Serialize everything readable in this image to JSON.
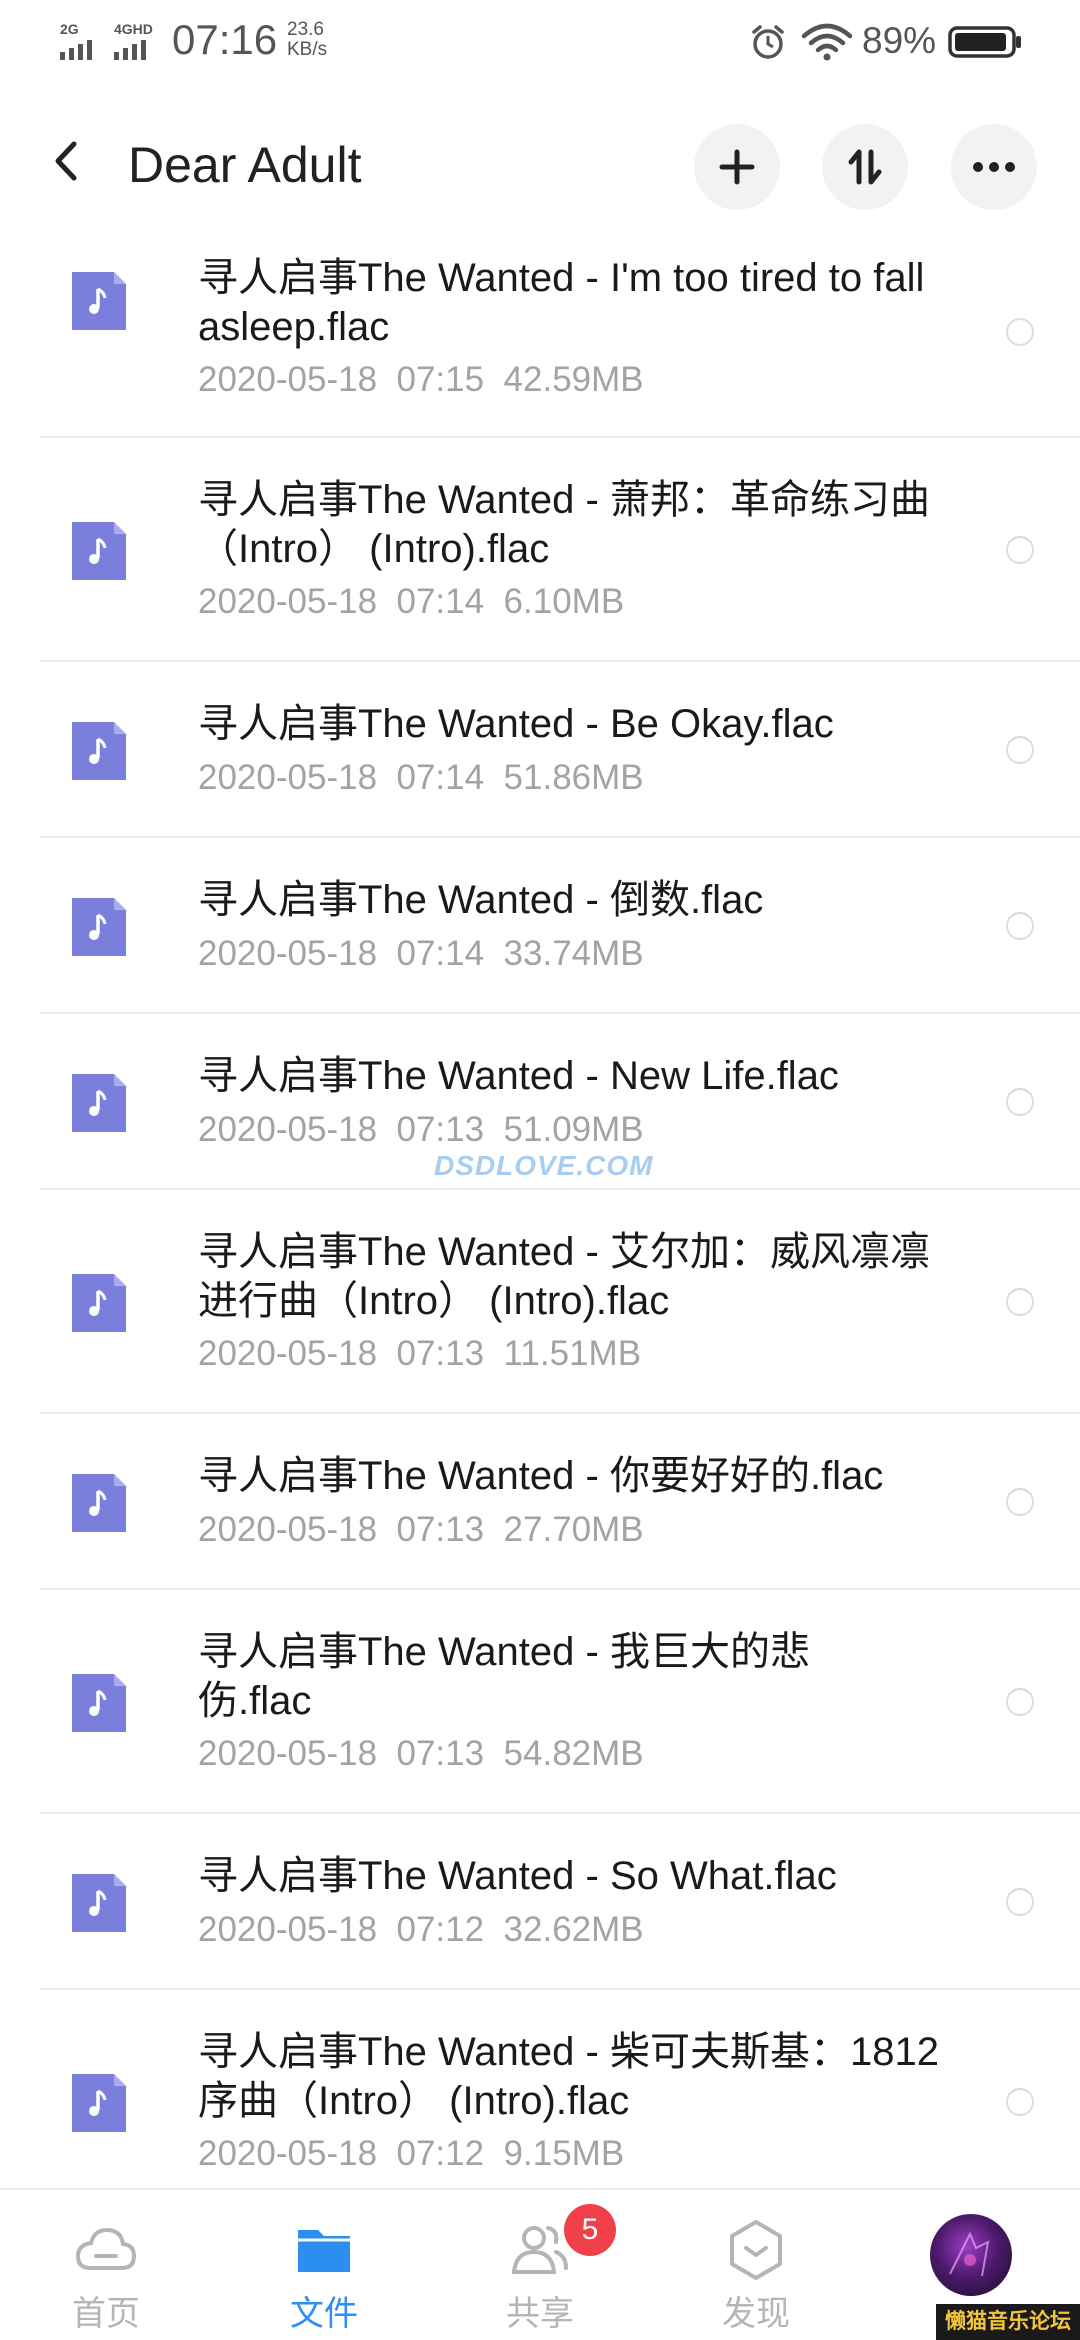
{
  "status_bar": {
    "net1": "2G",
    "net2": "4GHD",
    "time": "07:16",
    "speed_value": "23.6",
    "speed_unit": "KB/s",
    "battery": "89%",
    "icons": [
      "alarm-icon",
      "wifi-icon",
      "battery-icon"
    ]
  },
  "header": {
    "title": "Dear Adult",
    "buttons": [
      "back-icon",
      "add-icon",
      "sort-icon",
      "more-icon"
    ]
  },
  "files": [
    {
      "name": "寻人启事The Wanted - I'm too tired to fall asleep.flac",
      "date": "2020-05-18",
      "time": "07:15",
      "size": "42.59MB"
    },
    {
      "name": "寻人启事The Wanted - 萧邦：革命练习曲（Intro） (Intro).flac",
      "date": "2020-05-18",
      "time": "07:14",
      "size": "6.10MB"
    },
    {
      "name": "寻人启事The Wanted - Be Okay.flac",
      "date": "2020-05-18",
      "time": "07:14",
      "size": "51.86MB"
    },
    {
      "name": "寻人启事The Wanted - 倒数.flac",
      "date": "2020-05-18",
      "time": "07:14",
      "size": "33.74MB"
    },
    {
      "name": "寻人启事The Wanted - New Life.flac",
      "date": "2020-05-18",
      "time": "07:13",
      "size": "51.09MB"
    },
    {
      "name": "寻人启事The Wanted - 艾尔加：威风凛凛进行曲（Intro） (Intro).flac",
      "date": "2020-05-18",
      "time": "07:13",
      "size": "11.51MB"
    },
    {
      "name": "寻人启事The Wanted - 你要好好的.flac",
      "date": "2020-05-18",
      "time": "07:13",
      "size": "27.70MB"
    },
    {
      "name": "寻人启事The Wanted - 我巨大的悲伤.flac",
      "date": "2020-05-18",
      "time": "07:13",
      "size": "54.82MB"
    },
    {
      "name": "寻人启事The Wanted - So What.flac",
      "date": "2020-05-18",
      "time": "07:12",
      "size": "32.62MB"
    },
    {
      "name": "寻人启事The Wanted - 柴可夫斯基：1812序曲（Intro） (Intro).flac",
      "date": "2020-05-18",
      "time": "07:12",
      "size": "9.15MB"
    }
  ],
  "watermark": "DSDLOVE.COM",
  "bottom_nav": {
    "home": "首页",
    "files": "文件",
    "share": "共享",
    "share_badge": "5",
    "discover": "发现"
  },
  "forum_stamp": "懒猫音乐论坛",
  "colors": {
    "accent": "#2b8ef0",
    "file_icon": "#7b7fdc",
    "badge": "#f0414b"
  }
}
